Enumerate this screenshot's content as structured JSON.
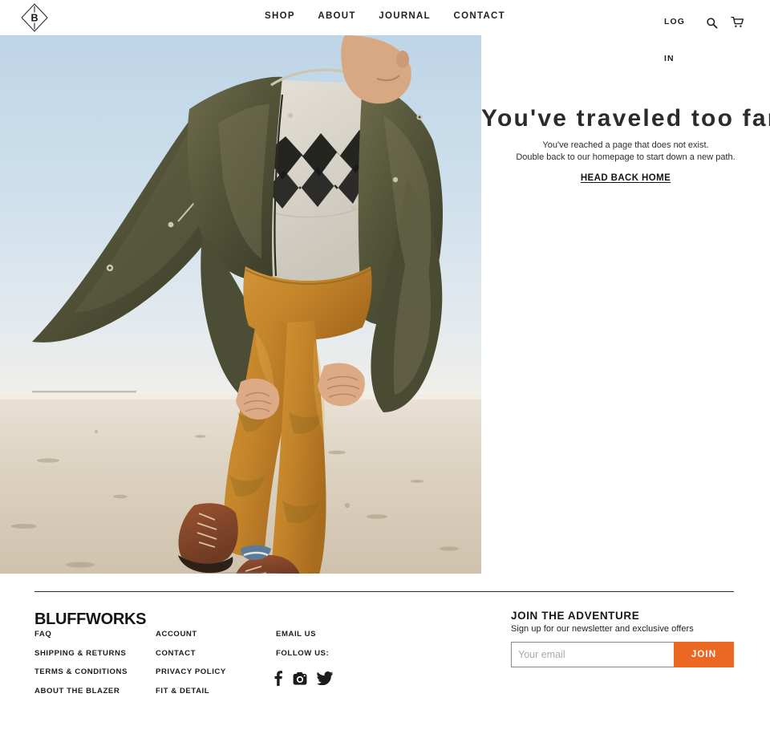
{
  "header": {
    "logo_letter": "B",
    "logo_name": "bluffworks-diamond-logo",
    "nav": [
      {
        "label": "SHOP",
        "name": "shop"
      },
      {
        "label": "ABOUT",
        "name": "about"
      },
      {
        "label": "JOURNAL",
        "name": "journal"
      },
      {
        "label": "CONTACT",
        "name": "contact"
      }
    ],
    "login_label": "LOG IN",
    "search_icon": "search-icon",
    "cart_icon": "cart-icon"
  },
  "hero": {
    "image_alt": "Man in olive jacket, cream patterned sweater and ochre pants walking on a sunlit salt flat",
    "title": "You've traveled too far",
    "line1": "You've reached a page that does not exist.",
    "line2": "Double back to our homepage to start down a new path.",
    "cta": "HEAD BACK HOME"
  },
  "footer": {
    "brand": "BLUFFWORKS",
    "columns": [
      {
        "name": "column-1",
        "links": [
          "FAQ",
          "SHIPPING & RETURNS",
          "TERMS & CONDITIONS",
          "ABOUT THE BLAZER"
        ]
      },
      {
        "name": "column-2",
        "links": [
          "ACCOUNT",
          "CONTACT",
          "PRIVACY POLICY",
          "FIT & DETAIL"
        ]
      },
      {
        "name": "column-3",
        "links": [
          "EMAIL US",
          "FOLLOW US:"
        ]
      }
    ],
    "socials": [
      {
        "name": "facebook-icon",
        "label": "Facebook"
      },
      {
        "name": "instagram-icon",
        "label": "Instagram"
      },
      {
        "name": "twitter-icon",
        "label": "Twitter"
      }
    ]
  },
  "newsletter": {
    "title": "JOIN THE ADVENTURE",
    "subtitle": "Sign up for our newsletter and exclusive offers",
    "placeholder": "Your email",
    "value": "",
    "button": "JOIN"
  },
  "colors": {
    "accent_orange": "#ec6722",
    "text": "#1c1c1c",
    "input_border": "#8a8a8a",
    "placeholder": "#a9a9a9",
    "sky_top": "#c3d8e8",
    "sky_horizon": "#eef0ee",
    "sand": "#ded3c2",
    "jacket_olive": "#4e4f35",
    "pants_ochre": "#c88a2e",
    "sweater_cream": "#ddd9cf"
  }
}
